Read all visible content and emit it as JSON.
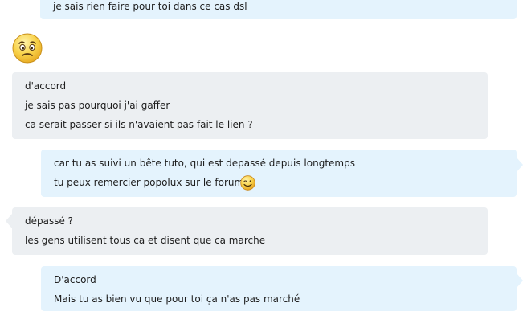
{
  "conversation": {
    "messages": [
      {
        "direction": "outgoing",
        "lines": [
          "je sais rien faire pour toi dans ce cas dsl"
        ]
      },
      {
        "direction": "incoming",
        "emoji": "worried-face-icon"
      },
      {
        "direction": "incoming",
        "lines": [
          "d'accord",
          "je sais pas pourquoi j'ai gaffer",
          "ca serait passer si ils n'avaient pas fait le lien ?"
        ]
      },
      {
        "direction": "outgoing",
        "lines": [
          "car tu as suivi un bête tuto, qui est depassé depuis longtemps",
          "tu peux remercier popolux sur le forum"
        ],
        "inline_emoji": "wink-smile-icon"
      },
      {
        "direction": "incoming",
        "lines": [
          "dépassé ?",
          "les gens utilisent tous ca et disent que ca marche"
        ]
      },
      {
        "direction": "outgoing",
        "lines": [
          "D'accord",
          "Mais tu as bien vu que pour toi ça n'as pas marché"
        ]
      }
    ]
  },
  "colors": {
    "outgoing_bubble": "#e4f3fd",
    "incoming_bubble": "#eceff2",
    "text": "#1e1e1e"
  }
}
